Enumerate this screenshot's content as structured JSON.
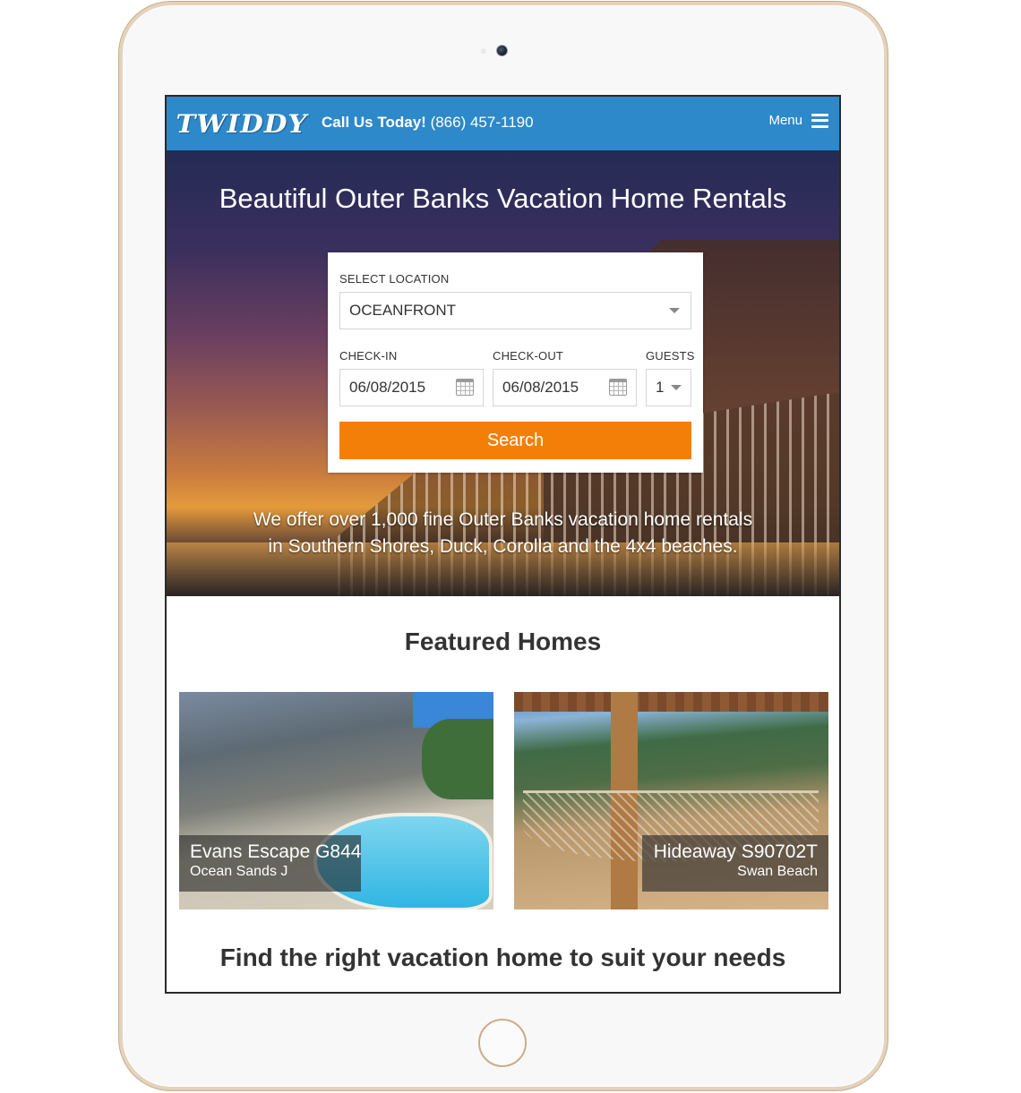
{
  "header": {
    "logo_text": "TWIDDY",
    "call_label": "Call Us Today!",
    "phone": "(866) 457-1190",
    "menu_label": "Menu"
  },
  "hero": {
    "title": "Beautiful Outer Banks Vacation Home Rentals",
    "copy_line1": "We offer over 1,000 fine Outer Banks vacation home rentals",
    "copy_line2": "in Southern Shores, Duck, Corolla and the 4x4 beaches."
  },
  "search": {
    "location_label": "SELECT LOCATION",
    "location_value": "OCEANFRONT",
    "checkin_label": "CHECK-IN",
    "checkin_value": "06/08/2015",
    "checkout_label": "CHECK-OUT",
    "checkout_value": "06/08/2015",
    "guests_label": "GUESTS",
    "guests_value": "1",
    "button_label": "Search"
  },
  "featured": {
    "title": "Featured Homes",
    "homes": [
      {
        "name": "Evans Escape G844",
        "location": "Ocean Sands J"
      },
      {
        "name": "Hideaway S90702T",
        "location": "Swan Beach"
      }
    ]
  },
  "needs_title": "Find the right vacation home to suit your needs",
  "colors": {
    "header_blue": "#2d89c9",
    "search_orange": "#f47f08"
  }
}
